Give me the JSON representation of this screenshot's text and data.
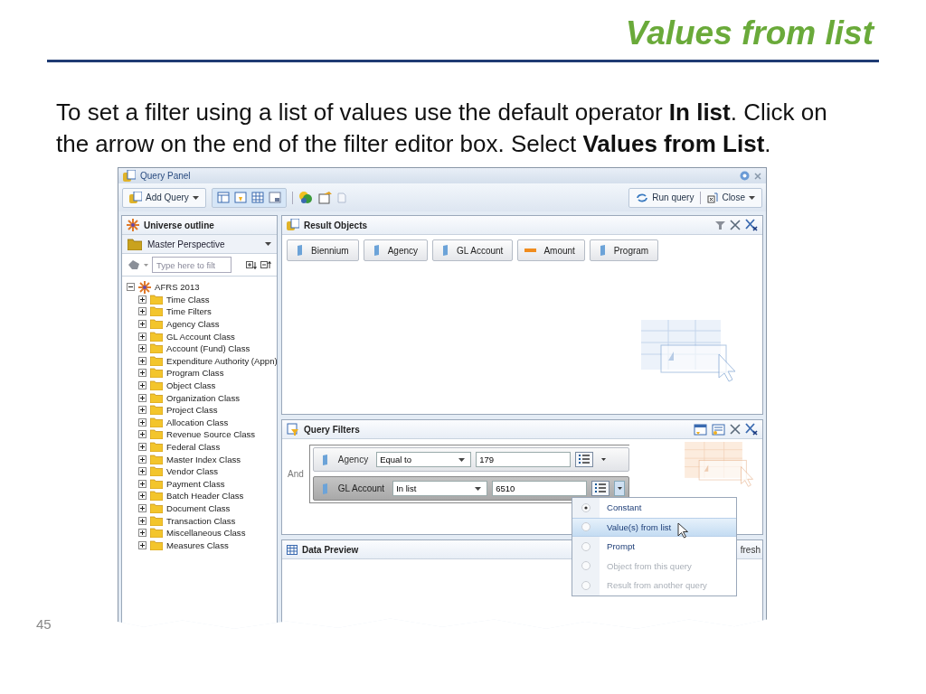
{
  "slide": {
    "title": "Values from list",
    "body": "To set a filter using a list of values use the default operator **In list**. Click on the arrow on the end of the filter editor box.  Select **Values from List**.",
    "page_number": "45"
  },
  "window": {
    "title": "Query Panel"
  },
  "toolbar": {
    "add_query": "Add Query",
    "run_query": "Run query",
    "close": "Close"
  },
  "outline": {
    "title": "Universe outline",
    "perspective": "Master Perspective",
    "search": {
      "placeholder": "Type here to filt"
    },
    "tree": [
      {
        "label": "AFRS 2013",
        "expanded": true,
        "children": [
          {
            "label": "Time Class",
            "expanded": false
          },
          {
            "label": "Time Filters",
            "expanded": false
          },
          {
            "label": "Agency Class",
            "expanded": false
          },
          {
            "label": "GL Account Class",
            "expanded": false
          },
          {
            "label": "Account (Fund) Class",
            "expanded": false
          },
          {
            "label": "Expenditure Authority (Appn)",
            "expanded": false
          },
          {
            "label": "Program Class",
            "expanded": false
          },
          {
            "label": "Object Class",
            "expanded": false
          },
          {
            "label": "Organization Class",
            "expanded": false
          },
          {
            "label": "Project Class",
            "expanded": false
          },
          {
            "label": "Allocation Class",
            "expanded": false
          },
          {
            "label": "Revenue Source Class",
            "expanded": false
          },
          {
            "label": "Federal Class",
            "expanded": false
          },
          {
            "label": "Master Index Class",
            "expanded": false
          },
          {
            "label": "Vendor Class",
            "expanded": false
          },
          {
            "label": "Payment Class",
            "expanded": false
          },
          {
            "label": "Batch Header Class",
            "expanded": false
          },
          {
            "label": "Document Class",
            "expanded": false
          },
          {
            "label": "Transaction Class",
            "expanded": false
          },
          {
            "label": "Miscellaneous Class",
            "expanded": false
          },
          {
            "label": "Measures Class",
            "expanded": false
          }
        ]
      }
    ]
  },
  "result_objects": {
    "title": "Result Objects",
    "items": [
      {
        "label": "Biennium",
        "kind": "dimension"
      },
      {
        "label": "Agency",
        "kind": "dimension"
      },
      {
        "label": "GL Account",
        "kind": "dimension"
      },
      {
        "label": "Amount",
        "kind": "measure"
      },
      {
        "label": "Program",
        "kind": "dimension"
      }
    ]
  },
  "query_filters": {
    "title": "Query Filters",
    "operator": "And",
    "filters": [
      {
        "object": "Agency",
        "operator": "Equal to",
        "value": "179",
        "selected": false
      },
      {
        "object": "GL Account",
        "operator": "In list",
        "value": "6510",
        "selected": true
      }
    ]
  },
  "data_preview": {
    "title": "Data Preview",
    "refresh": "fresh"
  },
  "menu": {
    "items": [
      {
        "label": "Constant",
        "selected": true,
        "highlighted": false,
        "disabled": false
      },
      {
        "label": "Value(s) from list",
        "selected": false,
        "highlighted": true,
        "disabled": false
      },
      {
        "label": "Prompt",
        "selected": false,
        "highlighted": false,
        "disabled": false
      },
      {
        "label": "Object from this query",
        "selected": false,
        "highlighted": false,
        "disabled": true
      },
      {
        "label": "Result from another query",
        "selected": false,
        "highlighted": false,
        "disabled": true
      }
    ]
  }
}
